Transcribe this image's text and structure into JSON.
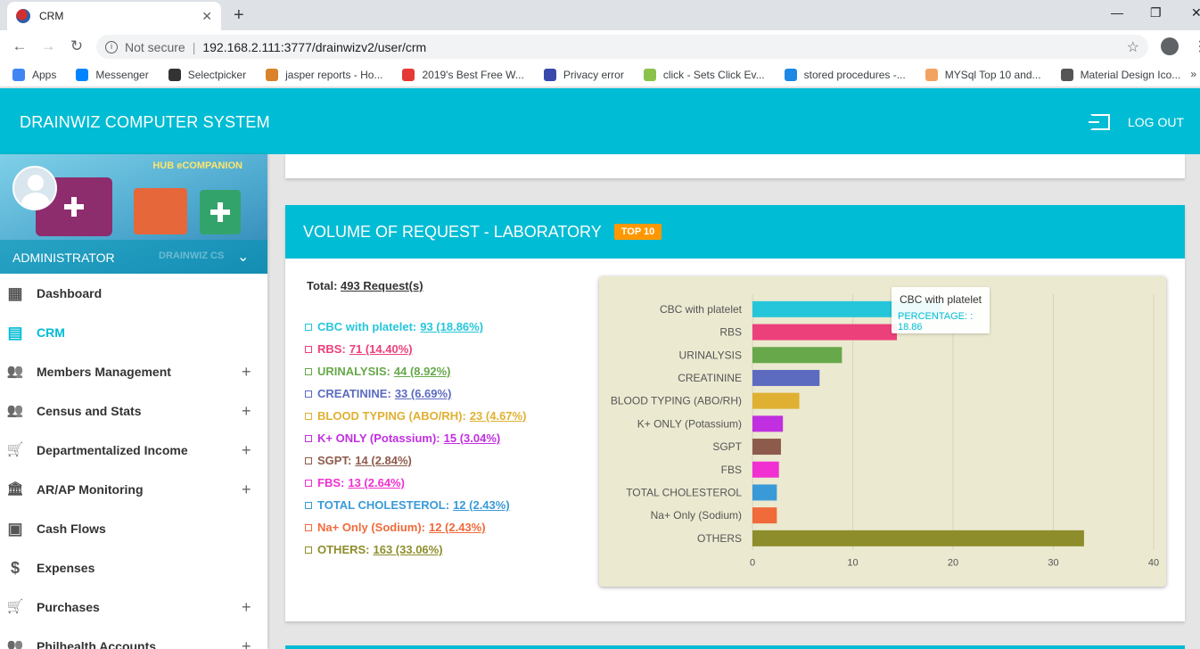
{
  "browser": {
    "tab_title": "CRM",
    "new_tab": "+",
    "not_secure": "Not secure",
    "url": "192.168.2.111:3777/drainwizv2/user/crm",
    "bookmarks": [
      {
        "label": "Apps",
        "color": "#4285f4"
      },
      {
        "label": "Messenger",
        "color": "#0084ff"
      },
      {
        "label": "Selectpicker",
        "color": "#333333"
      },
      {
        "label": "jasper reports - Ho...",
        "color": "#d9822b"
      },
      {
        "label": "2019's Best Free W...",
        "color": "#e53935"
      },
      {
        "label": "Privacy error",
        "color": "#3949ab"
      },
      {
        "label": "click - Sets Click Ev...",
        "color": "#8bc34a"
      },
      {
        "label": "stored procedures -...",
        "color": "#1e88e5"
      },
      {
        "label": "MYSql Top 10 and...",
        "color": "#f4a261"
      },
      {
        "label": "Material Design Ico...",
        "color": "#555555"
      }
    ],
    "bookmarks_more": "»"
  },
  "app": {
    "brand": "DRAINWIZ COMPUTER SYSTEM",
    "logout": "LOG OUT",
    "accent": "#00bcd4"
  },
  "sidebar": {
    "hub_label": "HUB eCOMPANION",
    "role": "ADMINISTRATOR",
    "watermark": "DRAINWIZ CS",
    "items": [
      {
        "label": "Dashboard",
        "icon": "dashboard-icon",
        "expandable": false,
        "active": false
      },
      {
        "label": "CRM",
        "icon": "document-icon",
        "expandable": false,
        "active": true
      },
      {
        "label": "Members Management",
        "icon": "people-icon",
        "expandable": true,
        "active": false
      },
      {
        "label": "Census and Stats",
        "icon": "people-icon",
        "expandable": true,
        "active": false
      },
      {
        "label": "Departmentalized Income",
        "icon": "cart-icon",
        "expandable": true,
        "active": false
      },
      {
        "label": "AR/AP Monitoring",
        "icon": "bank-icon",
        "expandable": true,
        "active": false
      },
      {
        "label": "Cash Flows",
        "icon": "wallet-icon",
        "expandable": false,
        "active": false
      },
      {
        "label": "Expenses",
        "icon": "dollar-icon",
        "expandable": false,
        "active": false
      },
      {
        "label": "Purchases",
        "icon": "cart-icon",
        "expandable": true,
        "active": false
      },
      {
        "label": "Philhealth Accounts",
        "icon": "people-icon",
        "expandable": true,
        "active": false
      }
    ]
  },
  "panel": {
    "title": "VOLUME OF REQUEST - LABORATORY",
    "badge": "TOP 10",
    "total_label": "Total:",
    "total_value": "493 Request(s)",
    "legend": [
      {
        "name": "CBC with platelet:",
        "value": "93 (18.86%)",
        "color": "#26c6da"
      },
      {
        "name": "RBS:",
        "value": "71 (14.40%)",
        "color": "#ec407a"
      },
      {
        "name": "URINALYSIS:",
        "value": "44 (8.92%)",
        "color": "#66a84a"
      },
      {
        "name": "CREATININE:",
        "value": "33 (6.69%)",
        "color": "#5c6bc0"
      },
      {
        "name": "BLOOD TYPING (ABO/RH):",
        "value": "23 (4.67%)",
        "color": "#e0b032"
      },
      {
        "name": "K+ ONLY (Potassium):",
        "value": "15 (3.04%)",
        "color": "#c030e0"
      },
      {
        "name": "SGPT:",
        "value": "14 (2.84%)",
        "color": "#8d5b4c"
      },
      {
        "name": "FBS:",
        "value": "13 (2.64%)",
        "color": "#f030d0"
      },
      {
        "name": "TOTAL CHOLESTEROL:",
        "value": "12 (2.43%)",
        "color": "#3a9ad8"
      },
      {
        "name": "Na+ Only (Sodium):",
        "value": "12 (2.43%)",
        "color": "#f06a3a"
      },
      {
        "name": "OTHERS:",
        "value": "163 (33.06%)",
        "color": "#8d8d2c"
      }
    ],
    "tooltip": {
      "title": "CBC with platelet",
      "value": "PERCENTAGE: : 18.86"
    }
  },
  "chart_data": {
    "type": "bar",
    "orientation": "horizontal",
    "categories": [
      "CBC with platelet",
      "RBS",
      "URINALYSIS",
      "CREATININE",
      "BLOOD TYPING (ABO/RH)",
      "K+ ONLY (Potassium)",
      "SGPT",
      "FBS",
      "TOTAL CHOLESTEROL",
      "Na+ Only (Sodium)",
      "OTHERS"
    ],
    "values": [
      18.86,
      14.4,
      8.92,
      6.69,
      4.67,
      3.04,
      2.84,
      2.64,
      2.43,
      2.43,
      33.06
    ],
    "colors": [
      "#26c6da",
      "#ec407a",
      "#66a84a",
      "#5c6bc0",
      "#e0b032",
      "#c030e0",
      "#8d5b4c",
      "#f030d0",
      "#3a9ad8",
      "#f06a3a",
      "#8d8d2c"
    ],
    "xticks": [
      0,
      10,
      20,
      30,
      40
    ],
    "xlim": [
      0,
      40
    ],
    "grid": true,
    "background": "#ebe9d0"
  }
}
